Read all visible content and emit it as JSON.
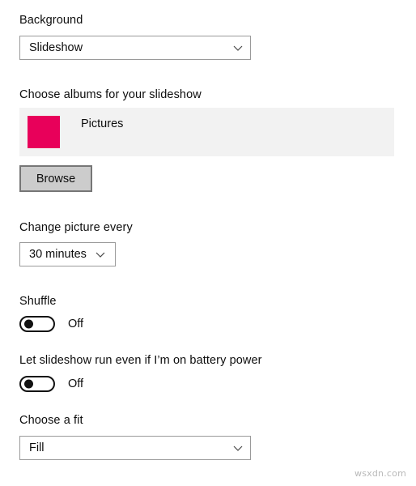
{
  "background_section": {
    "label": "Background",
    "dropdown": {
      "value": "Slideshow",
      "icon": "chevron-down-icon"
    }
  },
  "albums_section": {
    "label": "Choose albums for your slideshow",
    "albums": [
      {
        "name": "Pictures",
        "swatch_color": "#E8005A"
      }
    ],
    "browse_button": "Browse"
  },
  "interval_section": {
    "label": "Change picture every",
    "dropdown": {
      "value": "30 minutes",
      "icon": "chevron-down-icon"
    }
  },
  "shuffle_section": {
    "label": "Shuffle",
    "toggle": {
      "state": "Off",
      "on": false
    }
  },
  "battery_section": {
    "label": "Let slideshow run even if I’m on battery power",
    "toggle": {
      "state": "Off",
      "on": false
    }
  },
  "fit_section": {
    "label": "Choose a fit",
    "dropdown": {
      "value": "Fill",
      "icon": "chevron-down-icon"
    }
  },
  "watermark": {
    "text": "wsxdn.com"
  },
  "colors": {
    "page_background": "#FFFFFF",
    "panel_background": "#F2F2F2",
    "control_border": "#9A9A9A",
    "button_face": "#CCCCCC",
    "button_border": "#767676",
    "accent_swatch": "#E8005A",
    "text": "#0D0D0D"
  }
}
